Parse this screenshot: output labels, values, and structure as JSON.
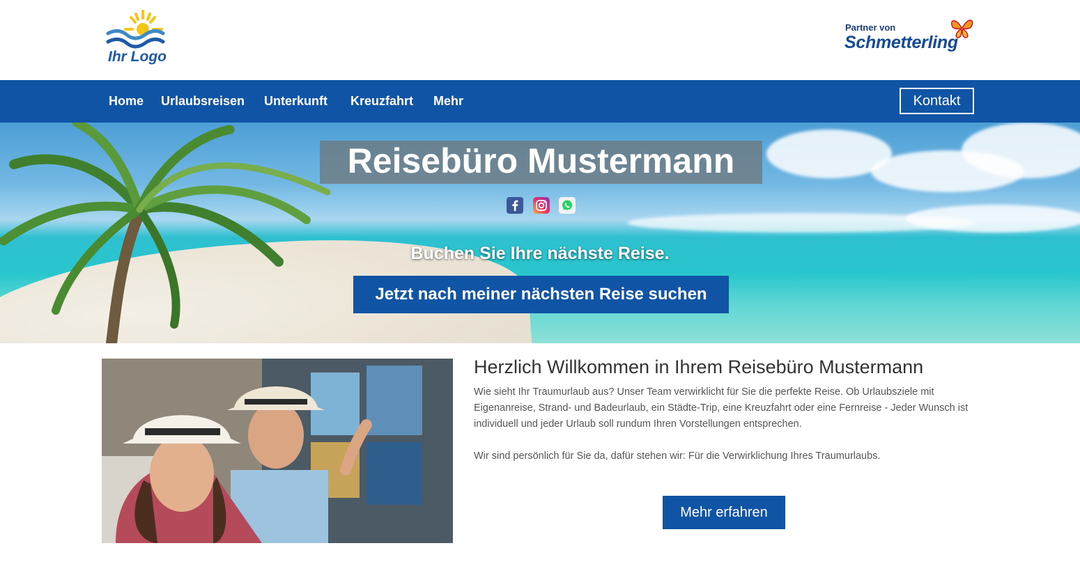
{
  "header": {
    "logo_text": "Ihr Logo",
    "partner_small": "Partner von",
    "partner_big": "Schmetterling"
  },
  "nav": {
    "items": [
      "Home",
      "Urlaubsreisen",
      "Unterkunft",
      "Kreuzfahrt",
      "Mehr"
    ],
    "contact_label": "Kontakt"
  },
  "hero": {
    "title": "Reisebüro Mustermann",
    "social_icons": [
      "facebook-icon",
      "instagram-icon",
      "whatsapp-icon"
    ],
    "subtitle": "Buchen Sie Ihre nächste Reise.",
    "search_button": "Jetzt nach meiner nächsten Reise suchen"
  },
  "content": {
    "title": "Herzlich Willkommen in Ihrem Reisebüro Mustermann",
    "paragraph1": "Wie sieht Ihr Traumurlaub aus? Unser Team verwirklicht für Sie die perfekte Reise. Ob Urlaubsziele mit Eigenanreise, Strand- und Badeurlaub, ein Städte-Trip, eine Kreuzfahrt oder eine Fernreise - Jeder Wunsch ist individuell und jeder Urlaub soll rundum Ihren Vorstellungen entsprechen.",
    "paragraph2": "Wir sind persönlich für Sie da, dafür stehen wir: Für die Verwirklichung Ihres Traumurlaubs.",
    "more_button": "Mehr erfahren"
  },
  "colors": {
    "brand_blue": "#1055a5",
    "logo_yellow": "#f5c518",
    "butterfly_orange": "#f39a1e"
  }
}
